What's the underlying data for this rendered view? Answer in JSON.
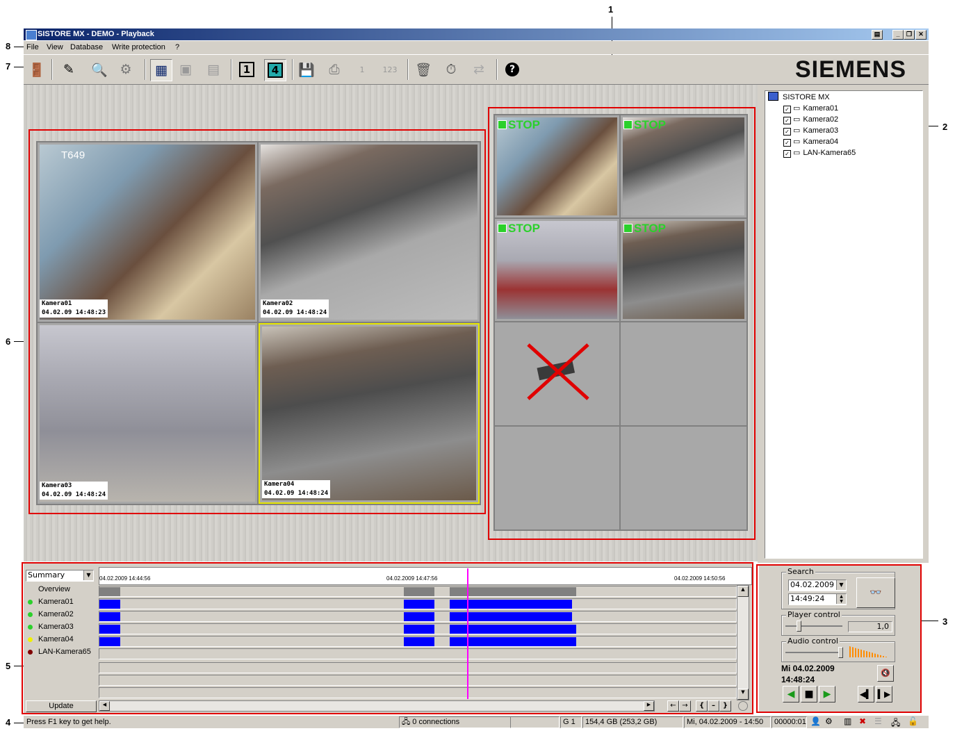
{
  "callouts": [
    "1",
    "2",
    "3",
    "4",
    "5",
    "6",
    "7",
    "8"
  ],
  "window": {
    "title": "SISTORE MX - DEMO - Playback"
  },
  "menu": {
    "file": "File",
    "view": "View",
    "database": "Database",
    "write_protection": "Write protection",
    "help": "?"
  },
  "toolbar": {
    "brand": "SIEMENS",
    "layout_1": "1",
    "layout_4": "4",
    "disabled_1": "1",
    "disabled_123": "123",
    "help_icon": "?"
  },
  "main_cameras": [
    {
      "name": "Kamera01",
      "stamp": "04.02.09 14:48:23",
      "overlay": "T649"
    },
    {
      "name": "Kamera02",
      "stamp": "04.02.09 14:48:24"
    },
    {
      "name": "Kamera03",
      "stamp": "04.02.09 14:48:24"
    },
    {
      "name": "Kamera04",
      "stamp": "04.02.09 14:48:24"
    }
  ],
  "thumb_grid": {
    "stop_label": "STOP"
  },
  "tree": {
    "root": "SISTORE MX",
    "items": [
      "Kamera01",
      "Kamera02",
      "Kamera03",
      "Kamera04",
      "LAN-Kamera65"
    ]
  },
  "timeline": {
    "view_select": "Summary",
    "time_start": "04.02.2009 14:44:56",
    "time_mid": "04.02.2009 14:47:56",
    "time_end": "04.02.2009 14:50:56",
    "overview_label": "Overview",
    "cameras": [
      {
        "name": "Kamera01",
        "led": "#2bd02b"
      },
      {
        "name": "Kamera02",
        "led": "#2bd02b"
      },
      {
        "name": "Kamera03",
        "led": "#2bd02b"
      },
      {
        "name": "Kamera04",
        "led": "#f0f000"
      },
      {
        "name": "LAN-Kamera65",
        "led": "#800000"
      }
    ],
    "update_button": "Update",
    "nav_buttons": [
      "←",
      "→",
      "{",
      "–",
      "}"
    ]
  },
  "search_panel": {
    "search_label": "Search",
    "date": "04.02.2009",
    "time": "14:49:24",
    "player_label": "Player control",
    "speed": "1,0",
    "audio_label": "Audio control",
    "current_date": "Mi 04.02.2009",
    "current_time": "14:48:24"
  },
  "status": {
    "help": "Press F1 key to get help.",
    "connections": "0 connections",
    "group": "G 1",
    "storage": "154,4 GB (253,2 GB)",
    "datetime": "Mi, 04.02.2009 - 14:50",
    "counter": "00000:01"
  }
}
